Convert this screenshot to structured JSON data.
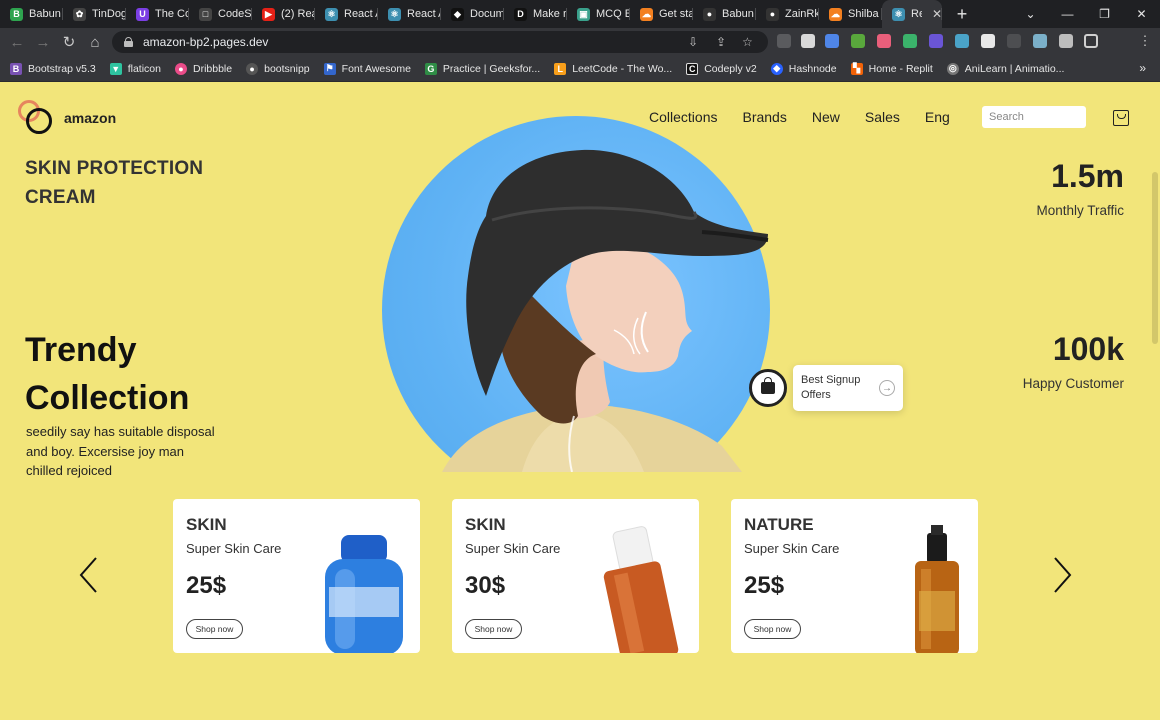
{
  "browser": {
    "tabs": [
      {
        "label": "Babun",
        "fav_color": "#2ea44f",
        "fav_glyph": "B"
      },
      {
        "label": "TinDog",
        "fav_color": "#444",
        "fav_glyph": "✿"
      },
      {
        "label": "The Co",
        "fav_color": "#7b3fe4",
        "fav_glyph": "U"
      },
      {
        "label": "CodeS",
        "fav_color": "#444",
        "fav_glyph": "□"
      },
      {
        "label": "(2) Rea",
        "fav_color": "#e62117",
        "fav_glyph": "▶"
      },
      {
        "label": "React A",
        "fav_color": "#3d8fb0",
        "fav_glyph": "⚛"
      },
      {
        "label": "React A",
        "fav_color": "#3d8fb0",
        "fav_glyph": "⚛"
      },
      {
        "label": "Docum",
        "fav_color": "#111",
        "fav_glyph": "◆"
      },
      {
        "label": "Make r",
        "fav_color": "#111",
        "fav_glyph": "D"
      },
      {
        "label": "MCQ E",
        "fav_color": "#3aa18c",
        "fav_glyph": "▣"
      },
      {
        "label": "Get sta",
        "fav_color": "#f38020",
        "fav_glyph": "☁"
      },
      {
        "label": "Babun",
        "fav_color": "#333",
        "fav_glyph": "●"
      },
      {
        "label": "ZainRk",
        "fav_color": "#333",
        "fav_glyph": "●"
      },
      {
        "label": "Shilba",
        "fav_color": "#f38020",
        "fav_glyph": "☁"
      },
      {
        "label": "Re",
        "fav_color": "#3d8fb0",
        "fav_glyph": "⚛",
        "active": true
      }
    ],
    "url": "amazon-bp2.pages.dev",
    "bookmarks": [
      {
        "label": "Bootstrap v5.3",
        "icon_color": "#7952b3",
        "glyph": "B"
      },
      {
        "label": "flaticon",
        "icon_color": "#2ec4a0",
        "glyph": "▼"
      },
      {
        "label": "Dribbble",
        "icon_color": "#ea4c89",
        "glyph": "●"
      },
      {
        "label": "bootsnipp",
        "icon_color": "#555",
        "glyph": "●"
      },
      {
        "label": "Font Awesome",
        "icon_color": "#3366cc",
        "glyph": "⚑"
      },
      {
        "label": "Practice | Geeksfor...",
        "icon_color": "#2f8d46",
        "glyph": "G"
      },
      {
        "label": "LeetCode - The Wo...",
        "icon_color": "#f89f1b",
        "glyph": "L"
      },
      {
        "label": "Codeply v2",
        "icon_color": "#111",
        "glyph": "C"
      },
      {
        "label": "Hashnode",
        "icon_color": "#2962ff",
        "glyph": "◆"
      },
      {
        "label": "Home - Replit",
        "icon_color": "#f26207",
        "glyph": "▚"
      },
      {
        "label": "AniLearn | Animatio...",
        "icon_color": "#777",
        "glyph": "◎"
      }
    ],
    "bookmarks_more": "»"
  },
  "header": {
    "brand": "amazon",
    "nav": [
      "Collections",
      "Brands",
      "New",
      "Sales",
      "Eng"
    ],
    "search_placeholder": "Search"
  },
  "hero": {
    "skin_title": "SKIN PROTECTION CREAM",
    "trendy_title": "Trendy Collection",
    "trendy_desc": "seedily say has suitable disposal and boy. Excersise joy man chilled rejoiced",
    "stats": [
      {
        "value": "1.5m",
        "label": "Monthly Traffic"
      },
      {
        "value": "100k",
        "label": "Happy Customer"
      }
    ],
    "signup_text": "Best Signup Offers"
  },
  "products": [
    {
      "category": "SKIN",
      "subtitle": "Super Skin Care",
      "price": "25$",
      "button": "Shop now",
      "bottle": "blue"
    },
    {
      "category": "SKIN",
      "subtitle": "Super Skin Care",
      "price": "30$",
      "button": "Shop now",
      "bottle": "orange"
    },
    {
      "category": "NATURE",
      "subtitle": "Super Skin Care",
      "price": "25$",
      "button": "Shop now",
      "bottle": "amber"
    }
  ],
  "colors": {
    "page_bg": "#f2e57a",
    "hero_disc": "#5fb2f4",
    "logo_ring_accent": "#e6855e"
  }
}
